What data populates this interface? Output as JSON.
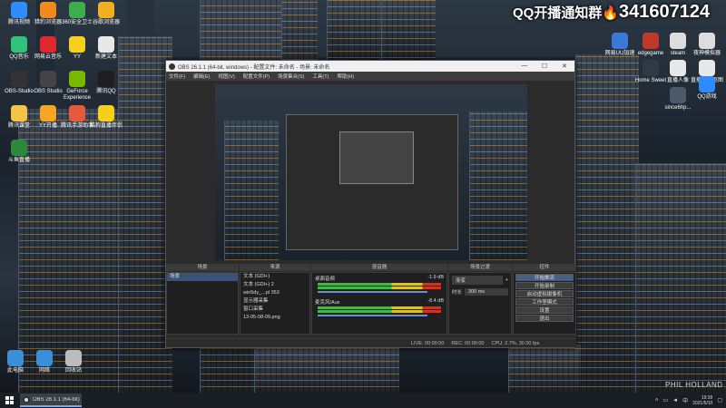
{
  "banner": {
    "prefix": "QQ开播通知群",
    "number": "341607124"
  },
  "desktop_icons_left": [
    {
      "label": "腾讯视频",
      "color": "#2f8cff"
    },
    {
      "label": "猎豹浏览器",
      "color": "#f08a1d"
    },
    {
      "label": "360安全卫士",
      "color": "#3bb04a"
    },
    {
      "label": "谷歌浏览器",
      "color": "#f0b020"
    },
    {
      "label": "QQ音乐",
      "color": "#31c27c"
    },
    {
      "label": "网易云音乐",
      "color": "#e0282e"
    },
    {
      "label": "YY",
      "color": "#f5d11b"
    },
    {
      "label": "新建文本",
      "color": "#e8e8e8"
    },
    {
      "label": "OBS-Studio",
      "color": "#333333"
    },
    {
      "label": "OBS Studio",
      "color": "#444444"
    },
    {
      "label": "GeForce Experience",
      "color": "#76b900"
    },
    {
      "label": "腾讯QQ",
      "color": "#1e1e1e"
    },
    {
      "label": "腾讯课堂",
      "color": "#f6c344"
    },
    {
      "label": "YY开播",
      "color": "#f5a623"
    },
    {
      "label": "腾讯手游助手",
      "color": "#e55a3c"
    },
    {
      "label": "酷狗直播伴侣",
      "color": "#f5d01b"
    },
    {
      "label": "斗鱼直播",
      "color": "#2a8a3a"
    }
  ],
  "desktop_icons_right": [
    {
      "label": "网易UU加速",
      "color": "#3b79d8"
    },
    {
      "label": "edgegame",
      "color": "#c0392b"
    },
    {
      "label": "steam",
      "color": "#dddddd"
    },
    {
      "label": "夜神模拟器",
      "color": "#dddddd"
    },
    {
      "label": "Home Sweet",
      "color": "#2f3a44"
    },
    {
      "label": "直播人像",
      "color": "#e8e8e8"
    },
    {
      "label": "直播人像抠图",
      "color": "#e8e8e8"
    },
    {
      "label": "since6hp...",
      "color": "#4a5a6a"
    },
    {
      "label": "QQ游戏",
      "color": "#2f8cff"
    }
  ],
  "desktop_icons_bottom": [
    {
      "label": "此电脑",
      "color": "#3a8fd8"
    },
    {
      "label": "网络",
      "color": "#3a8fd8"
    },
    {
      "label": "回收站",
      "color": "#bcbcbc"
    }
  ],
  "obs": {
    "title": "OBS 26.1.1 (64-bit, windows) - 配置文件: 未命名 - 场景: 未命名",
    "menu": [
      "文件(F)",
      "编辑(E)",
      "视图(V)",
      "配置文件(P)",
      "场景集合(S)",
      "工具(T)",
      "帮助(H)"
    ],
    "docks": {
      "scenes_header": "场景",
      "sources_header": "来源",
      "mixer_header": "混音器",
      "transitions_header": "场景过渡",
      "controls_header": "控件",
      "transition_label": "渐变",
      "duration_label": "时长",
      "duration_value": "300 ms"
    },
    "scenes": [
      "场景"
    ],
    "sources": [
      "文本 (GDI+)",
      "文本 (GDI+) 2",
      "win5dy_...pl 353",
      "显示器采集",
      "窗口采集",
      "13-05-08-09.png"
    ],
    "mixer": [
      {
        "name": "桌面音频",
        "db": "-1.9 dB"
      },
      {
        "name": "麦克风/Aux",
        "db": "-8.4 dB"
      }
    ],
    "controls": [
      "开始推流",
      "开始录制",
      "启动虚拟摄像机",
      "工作室模式",
      "设置",
      "退出"
    ],
    "status": {
      "live": "LIVE: 00:00:00",
      "rec": "REC: 00:00:00",
      "cpu": "CPU: 2.7%, 30.00 fps"
    }
  },
  "taskbar": {
    "task_label": "OBS 26.1.1 (64-bit)",
    "time": "19:39",
    "date": "2021/5/10"
  },
  "watermark": "PHIL HOLLAND"
}
